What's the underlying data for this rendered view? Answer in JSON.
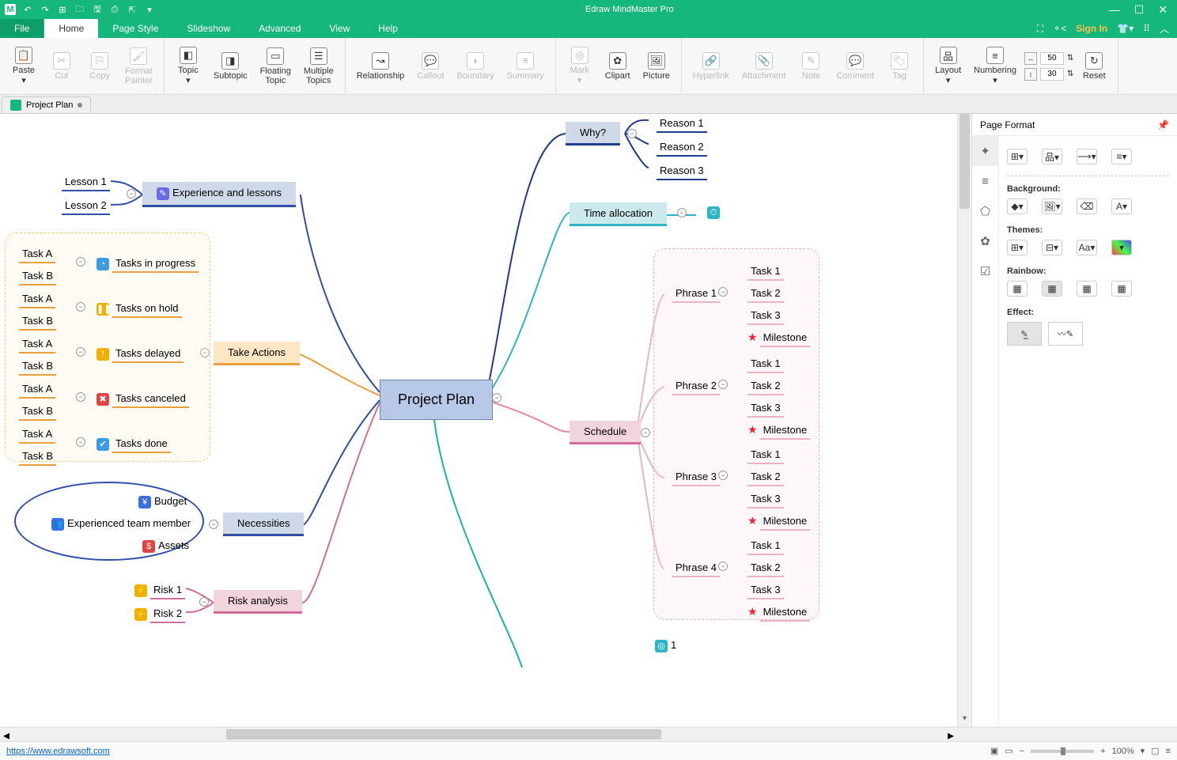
{
  "app": {
    "title": "Edraw MindMaster Pro"
  },
  "menus": {
    "file": "File",
    "home": "Home",
    "pagestyle": "Page Style",
    "slideshow": "Slideshow",
    "advanced": "Advanced",
    "view": "View",
    "help": "Help",
    "signin": "Sign In"
  },
  "ribbon": {
    "paste": "Paste",
    "cut": "Cut",
    "copy": "Copy",
    "formatpainter": "Format\nPainter",
    "topic": "Topic",
    "subtopic": "Subtopic",
    "floating": "Floating\nTopic",
    "multi": "Multiple\nTopics",
    "relationship": "Relationship",
    "callout": "Callout",
    "boundary": "Boundary",
    "summary": "Summary",
    "mark": "Mark",
    "clipart": "Clipart",
    "picture": "Picture",
    "hyperlink": "Hyperlink",
    "attachment": "Attachment",
    "note": "Note",
    "comment": "Comment",
    "tag": "Tag",
    "layout": "Layout",
    "numbering": "Numbering",
    "hspace": "50",
    "vspace": "30",
    "reset": "Reset"
  },
  "doc": {
    "name": "Project Plan"
  },
  "sidepanel": {
    "title": "Page Format",
    "background": "Background:",
    "themes": "Themes:",
    "rainbow": "Rainbow:",
    "effect": "Effect:"
  },
  "status": {
    "url": "https://www.edrawsoft.com",
    "zoom": "100%"
  },
  "map": {
    "center": "Project Plan",
    "why": "Why?",
    "reasons": [
      "Reason 1",
      "Reason 2",
      "Reason 3"
    ],
    "time": "Time allocation",
    "schedule": "Schedule",
    "phrases": [
      "Phrase 1",
      "Phrase 2",
      "Phrase 3",
      "Phrase 4"
    ],
    "tasks": [
      "Task 1",
      "Task 2",
      "Task 3"
    ],
    "milestone": "Milestone",
    "exp": "Experience and lessons",
    "lessons": [
      "Lesson 1",
      "Lesson 2"
    ],
    "take": "Take Actions",
    "actionLabels": [
      "Tasks in progress",
      "Tasks on hold",
      "Tasks delayed",
      "Tasks canceled",
      "Tasks done"
    ],
    "ab": [
      "Task A",
      "Task B"
    ],
    "nec": "Necessities",
    "necitems": [
      "Budget",
      "Experienced team member",
      "Assets"
    ],
    "risk": "Risk analysis",
    "risks": [
      "Risk 1",
      "Risk 2"
    ],
    "pagenum": "1"
  }
}
